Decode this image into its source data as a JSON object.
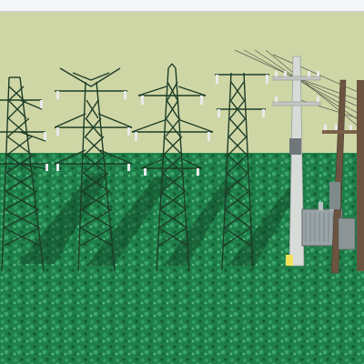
{
  "scene": {
    "colors": {
      "sky": "#cfd6a6",
      "ground": "#1f7f4a",
      "ground_dark": "#145c34",
      "ground_light": "#3aa56a",
      "tower_steel": "#1d3d27",
      "insulator": "#e9e9e9",
      "pole_concrete": "#d8dcd8",
      "pole_wood": "#6b5540",
      "transformer": "#9aa3a6",
      "line": "#3b3b3b"
    },
    "objects": [
      {
        "kind": "transmission-tower",
        "variant": "double-circuit-a"
      },
      {
        "kind": "transmission-tower",
        "variant": "double-circuit-b"
      },
      {
        "kind": "transmission-tower",
        "variant": "triple-crossarm"
      },
      {
        "kind": "transmission-tower",
        "variant": "narrow-lattice"
      },
      {
        "kind": "utility-pole",
        "material": "concrete"
      },
      {
        "kind": "utility-pole",
        "material": "wood"
      },
      {
        "kind": "pad-transformer"
      }
    ]
  }
}
